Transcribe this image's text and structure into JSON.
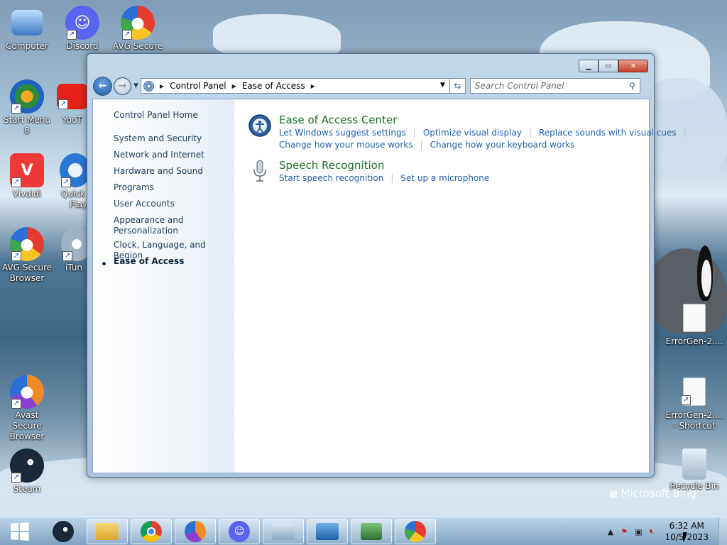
{
  "desktop": {
    "icons": [
      {
        "label": "Computer"
      },
      {
        "label": "Discord"
      },
      {
        "label": "AVG Secure"
      },
      {
        "label": "Start Menu 8"
      },
      {
        "label": "YouT"
      },
      {
        "label": "Vivaldi"
      },
      {
        "label": "Quick"
      },
      {
        "label": "Play"
      },
      {
        "label": "AVG Secure Browser"
      },
      {
        "label": "iTun"
      },
      {
        "label": "Avast Secure Browser"
      },
      {
        "label": "Steam"
      },
      {
        "label": "ErrorGen-2...."
      },
      {
        "label": "ErrorGen-2.... - Shortcut"
      },
      {
        "label": "Recycle Bin"
      }
    ],
    "watermark": "Microsoft Bing"
  },
  "window": {
    "breadcrumb": [
      "Control Panel",
      "Ease of Access"
    ],
    "search": {
      "placeholder": "Search Control Panel"
    },
    "left_pane": {
      "home": "Control Panel Home",
      "items": [
        "System and Security",
        "Network and Internet",
        "Hardware and Sound",
        "Programs",
        "User Accounts",
        "Appearance and",
        "Personalization",
        "Clock, Language, and Region",
        "Ease of Access"
      ]
    },
    "categories": [
      {
        "title": "Ease of Access Center",
        "links": [
          "Let Windows suggest settings",
          "Optimize visual display",
          "Replace sounds with visual cues",
          "Change how your mouse works",
          "Change how your keyboard works"
        ]
      },
      {
        "title": "Speech Recognition",
        "links": [
          "Start speech recognition",
          "Set up a microphone"
        ]
      }
    ]
  },
  "taskbar": {
    "time": "6:32 AM",
    "date": "10/5/2023"
  },
  "colors": {
    "link": "#1f5fb0",
    "category_title": "#1e6b2e",
    "nav_text": "#1e3a5c"
  }
}
